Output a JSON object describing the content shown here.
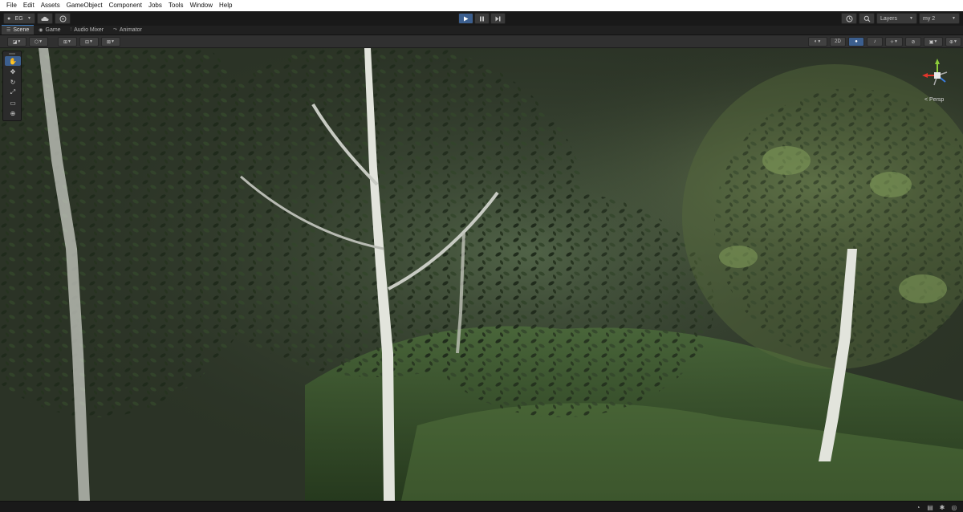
{
  "menu": [
    "File",
    "Edit",
    "Assets",
    "GameObject",
    "Component",
    "Jobs",
    "Tools",
    "Window",
    "Help"
  ],
  "toolbar": {
    "account_label": "EG",
    "cloud_icon": "cloud-icon",
    "collab_icon": "collab-icon",
    "play_icon": "play-icon",
    "pause_icon": "pause-icon",
    "step_icon": "step-icon",
    "history_icon": "history-icon",
    "search_icon": "search-icon",
    "layers_label": "Layers",
    "layout_label": "my 2"
  },
  "tabs": [
    {
      "label": "Scene",
      "icon": "scene-icon",
      "active": true
    },
    {
      "label": "Game",
      "icon": "game-icon",
      "active": false
    },
    {
      "label": "Audio Mixer",
      "icon": "audio-mixer-icon",
      "active": false
    },
    {
      "label": "Animator",
      "icon": "animator-icon",
      "active": false
    }
  ],
  "scene_toolbar": {
    "mode_2d_label": "2D"
  },
  "tools": [
    {
      "name": "hand",
      "glyph": "✋",
      "active": true
    },
    {
      "name": "move",
      "glyph": "✥",
      "active": false
    },
    {
      "name": "rotate",
      "glyph": "↻",
      "active": false
    },
    {
      "name": "scale",
      "glyph": "⤢",
      "active": false
    },
    {
      "name": "rect",
      "glyph": "▭",
      "active": false
    },
    {
      "name": "transform",
      "glyph": "⊕",
      "active": false
    }
  ],
  "gizmo": {
    "projection_label": "< Persp"
  },
  "colors": {
    "accent": "#3c5f8f",
    "menu_bg": "#ffffff",
    "editor_bg": "#191919",
    "panel_bg": "#303030",
    "axis_x": "#e0352b",
    "axis_y": "#8ccc3a",
    "axis_z": "#3b7de0"
  }
}
